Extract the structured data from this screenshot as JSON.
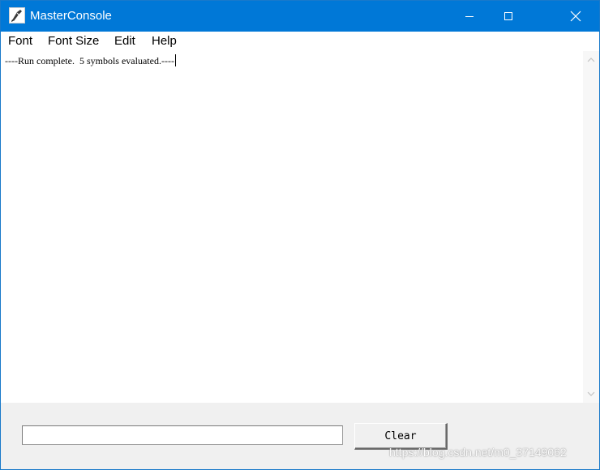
{
  "window": {
    "title": "MasterConsole",
    "icon": "app-pen-icon",
    "controls": {
      "minimize": "minimize-icon",
      "maximize": "maximize-icon",
      "close": "close-icon"
    },
    "accent_color": "#0078d7"
  },
  "menu": {
    "items": [
      {
        "label": "Font"
      },
      {
        "label": "Font Size"
      },
      {
        "label": "Edit"
      },
      {
        "label": "Help"
      }
    ]
  },
  "console": {
    "lines": [
      "----Run complete.  5 symbols evaluated.----"
    ]
  },
  "input": {
    "value": ""
  },
  "buttons": {
    "clear_label": "Clear"
  },
  "watermark": "https://blog.csdn.net/m0_37149062"
}
